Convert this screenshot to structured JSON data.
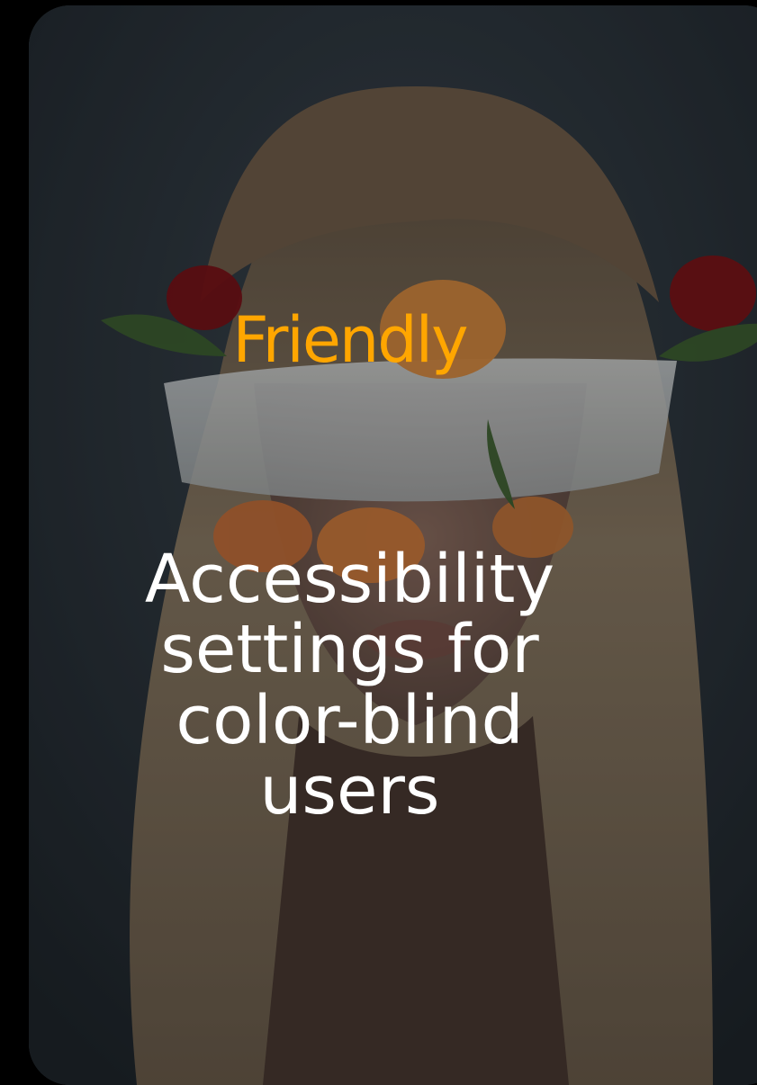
{
  "card": {
    "headline": "Friendly",
    "description_lines": [
      "Accessibility",
      "settings for",
      "color-blind",
      "users"
    ]
  },
  "colors": {
    "headline": "#ffa600",
    "description": "#ffffff",
    "page_background": "#000000"
  }
}
